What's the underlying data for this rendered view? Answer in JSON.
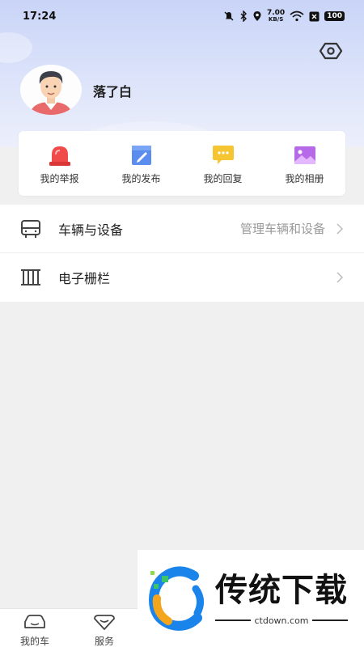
{
  "status_bar": {
    "time": "17:24",
    "net_speed_value": "7.00",
    "net_speed_unit": "KB/S",
    "battery": "100"
  },
  "profile": {
    "username": "落了白"
  },
  "quick_actions": [
    {
      "label": "我的举报",
      "icon": "alarm-light-icon",
      "color": "#f04a4a"
    },
    {
      "label": "我的发布",
      "icon": "edit-document-icon",
      "color": "#5b8def"
    },
    {
      "label": "我的回复",
      "icon": "chat-bubble-icon",
      "color": "#f5c533"
    },
    {
      "label": "我的相册",
      "icon": "photo-album-icon",
      "color": "#b76ae8"
    }
  ],
  "menu": [
    {
      "label": "车辆与设备",
      "sub": "管理车辆和设备",
      "icon": "vehicle-icon"
    },
    {
      "label": "电子栅栏",
      "sub": "",
      "icon": "fence-icon"
    }
  ],
  "bottom_nav": [
    {
      "label": "我的车",
      "icon": "car-icon"
    },
    {
      "label": "服务",
      "icon": "service-icon"
    }
  ],
  "watermark": {
    "title": "传统下载",
    "domain": "ctdown.com"
  }
}
